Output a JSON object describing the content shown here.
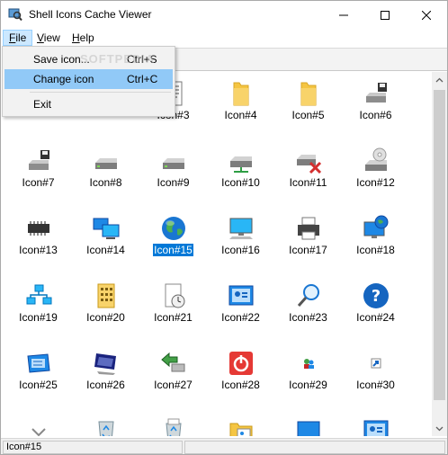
{
  "window": {
    "title": "Shell Icons Cache Viewer"
  },
  "menubar": {
    "file": {
      "pre": "",
      "ul": "F",
      "post": "ile"
    },
    "view": {
      "pre": "",
      "ul": "V",
      "post": "iew"
    },
    "help": {
      "pre": "",
      "ul": "H",
      "post": "elp"
    }
  },
  "file_menu": {
    "save_label": "Save icon...",
    "save_shortcut": "Ctrl+S",
    "change_label": "Change icon",
    "change_shortcut": "Ctrl+C",
    "exit_label": "Exit"
  },
  "watermark": "SOFTPEDIA",
  "icons": [
    {
      "label": "",
      "icon": "document-icon"
    },
    {
      "label": "",
      "icon": "document-icon"
    },
    {
      "label": "Icon#3",
      "icon": "text-document-icon"
    },
    {
      "label": "Icon#4",
      "icon": "folder-icon"
    },
    {
      "label": "Icon#5",
      "icon": "folder-icon"
    },
    {
      "label": "Icon#6",
      "icon": "floppy-drive-icon"
    },
    {
      "label": "Icon#7",
      "icon": "floppy-drive-icon"
    },
    {
      "label": "Icon#8",
      "icon": "hard-drive-icon"
    },
    {
      "label": "Icon#9",
      "icon": "hard-drive-icon"
    },
    {
      "label": "Icon#10",
      "icon": "network-drive-icon"
    },
    {
      "label": "Icon#11",
      "icon": "disconnected-drive-icon"
    },
    {
      "label": "Icon#12",
      "icon": "cd-drive-icon"
    },
    {
      "label": "Icon#13",
      "icon": "memory-chip-icon"
    },
    {
      "label": "Icon#14",
      "icon": "network-computers-icon"
    },
    {
      "label": "Icon#15",
      "icon": "globe-icon"
    },
    {
      "label": "Icon#16",
      "icon": "computer-icon"
    },
    {
      "label": "Icon#17",
      "icon": "printer-icon"
    },
    {
      "label": "Icon#18",
      "icon": "internet-computer-icon"
    },
    {
      "label": "Icon#19",
      "icon": "network-icon"
    },
    {
      "label": "Icon#20",
      "icon": "programs-icon"
    },
    {
      "label": "Icon#21",
      "icon": "recent-documents-icon"
    },
    {
      "label": "Icon#22",
      "icon": "control-panel-icon"
    },
    {
      "label": "Icon#23",
      "icon": "search-icon"
    },
    {
      "label": "Icon#24",
      "icon": "help-icon"
    },
    {
      "label": "Icon#25",
      "icon": "run-icon"
    },
    {
      "label": "Icon#26",
      "icon": "monitor-icon"
    },
    {
      "label": "Icon#27",
      "icon": "log-off-icon"
    },
    {
      "label": "Icon#28",
      "icon": "shutdown-icon"
    },
    {
      "label": "Icon#29",
      "icon": "small-users-icon"
    },
    {
      "label": "Icon#30",
      "icon": "shortcut-arrow-icon"
    },
    {
      "label": "",
      "icon": "chevron-down-icon"
    },
    {
      "label": "",
      "icon": "recycle-bin-empty-icon"
    },
    {
      "label": "",
      "icon": "recycle-bin-full-icon"
    },
    {
      "label": "",
      "icon": "folder-shared-icon"
    },
    {
      "label": "",
      "icon": "desktop-icon"
    },
    {
      "label": "",
      "icon": "control-panel-icon"
    }
  ],
  "selected_icon": "Icon#15",
  "statusbar": {
    "text": "Icon#15",
    "secondary": ""
  },
  "colors": {
    "selection": "#0078d7",
    "menu_highlight": "#91c9f7",
    "folder": "#f5c542",
    "accent_blue": "#1e73be"
  }
}
